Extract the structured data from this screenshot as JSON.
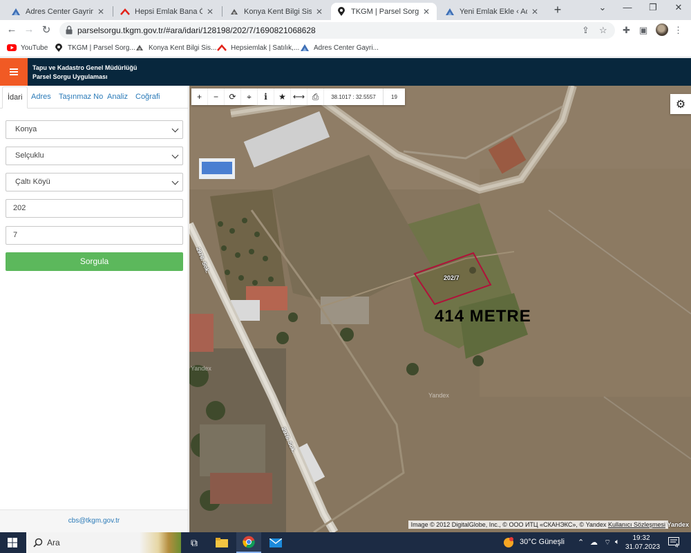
{
  "browser": {
    "tabs": [
      {
        "title": "Adres Center Gayrimenkul",
        "favicon": "adres-center-icon",
        "active": false
      },
      {
        "title": "Hepsi Emlak Bana Özel",
        "favicon": "hepsiemlak-icon",
        "active": false
      },
      {
        "title": "Konya Kent Bilgi Sistemi",
        "favicon": "konya-kent-icon",
        "active": false
      },
      {
        "title": "TKGM | Parsel Sorgu Uygu",
        "favicon": "map-pin-icon",
        "active": true
      },
      {
        "title": "Yeni Emlak Ekle ‹ Adres Ce",
        "favicon": "adres-center-icon",
        "active": false
      }
    ],
    "new_tab_symbol": "+",
    "url": "parselsorgu.tkgm.gov.tr/#ara/idari/128198/202/7/1690821068628",
    "bookmarks": [
      {
        "label": "YouTube",
        "icon": "youtube-icon"
      },
      {
        "label": "TKGM | Parsel Sorg...",
        "icon": "map-pin-icon"
      },
      {
        "label": "Konya Kent Bilgi Sis...",
        "icon": "konya-kent-icon"
      },
      {
        "label": "Hepsiemlak | Satılık,...",
        "icon": "hepsiemlak-icon"
      },
      {
        "label": "Adres Center Gayri...",
        "icon": "adres-center-icon"
      }
    ]
  },
  "app": {
    "title_line1": "Tapu ve Kadastro Genel Müdürlüğü",
    "title_line2": "Parsel Sorgu Uygulaması",
    "accent_color": "#f15a24",
    "header_color": "#08273d"
  },
  "panel": {
    "tabs": [
      "İdari",
      "Adres",
      "Taşınmaz No",
      "Analiz",
      "Coğrafi"
    ],
    "active_tab": "İdari",
    "il": "Konya",
    "ilce": "Selçuklu",
    "mahalle": "Çaltı Köyü",
    "ada": "202",
    "parsel": "7",
    "submit_label": "Sorgula",
    "submit_color": "#5cb85c",
    "footer_email": "cbs@tkgm.gov.tr"
  },
  "map": {
    "coordinates": "38.1017 : 32.5557",
    "zoom_level": "19",
    "parcel_label": "202/7",
    "area_annotation": "414 METRE",
    "street_label_1": "2976. Sok.",
    "street_label_2": "2976. Sok.",
    "watermark_1": "Yandex",
    "watermark_2": "Yandex",
    "attribution": "Image © 2012 DigitalGlobe, Inc., © ООО ИТЦ «СКАНЭКС», © Yandex",
    "terms_link": "Kullanıcı Sözleşmesi",
    "logo": "Yandex",
    "parcel_outline_color": "#b0123a"
  },
  "taskbar": {
    "search_placeholder": "Ara",
    "weather": "30°C  Güneşli",
    "time": "19:32",
    "date": "31.07.2023",
    "notification_count": "4"
  }
}
